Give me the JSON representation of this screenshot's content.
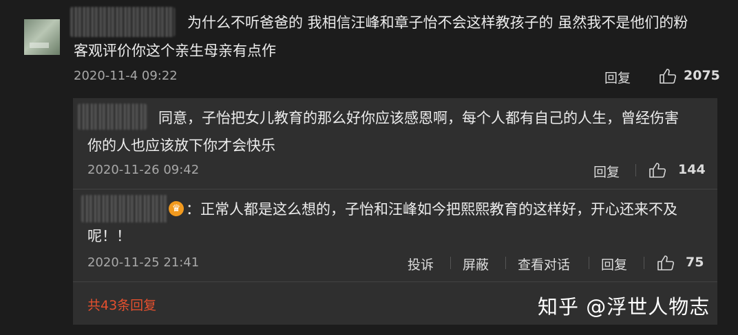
{
  "main_comment": {
    "text_line1": "为什么不听爸爸的 我相信汪峰和章子怡不会这样教孩子的 虽然我不是他们的粉",
    "text_line2": "客观评价你这个亲生母亲有点作",
    "timestamp": "2020-11-4 09:22",
    "reply_label": "回复",
    "likes": "2075"
  },
  "replies": [
    {
      "text_line1": "同意，子怡把女儿教育的那么好你应该感恩啊，每个人都有自己的人生，曾经伤害",
      "text_line2": "你的人也应该放下你才会快乐",
      "timestamp": "2020-11-26 09:42",
      "reply_label": "回复",
      "likes": "144"
    },
    {
      "text_line1": "：正常人都是这么想的，子怡和汪峰如今把熙熙教育的这样好，开心还来不及",
      "text_line2": "呢！！",
      "timestamp": "2020-11-25 21:41",
      "report_label": "投诉",
      "block_label": "屏蔽",
      "view_conversation_label": "查看对话",
      "reply_label": "回复",
      "likes": "75"
    }
  ],
  "more_replies_label": "共43条回复",
  "watermark": "知乎 @浮世人物志"
}
